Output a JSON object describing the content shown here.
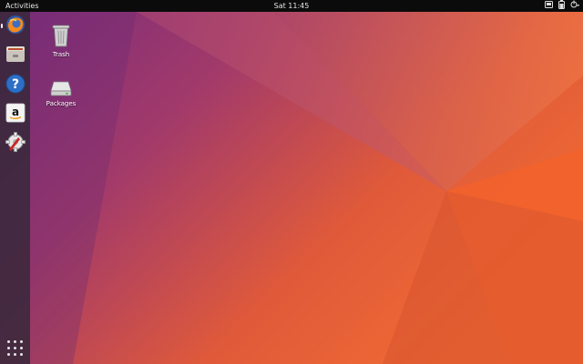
{
  "topbar": {
    "activities_label": "Activities",
    "clock": "Sat 11:45",
    "status_icons": [
      "network-icon",
      "battery-icon",
      "power-menu-icon"
    ]
  },
  "dock": {
    "items": [
      {
        "name": "firefox",
        "icon": "firefox-icon",
        "active": true
      },
      {
        "name": "files",
        "icon": "files-icon",
        "active": false
      },
      {
        "name": "help",
        "icon": "help-icon",
        "active": false
      },
      {
        "name": "amazon",
        "icon": "amazon-icon",
        "active": false
      },
      {
        "name": "software-updater",
        "icon": "software-updater-icon",
        "active": false
      }
    ],
    "show_apps_icon": "app-grid-icon"
  },
  "desktop": {
    "icons": [
      {
        "label": "Trash",
        "icon": "trash-icon"
      },
      {
        "label": "Packages",
        "icon": "drive-icon"
      }
    ]
  },
  "colors": {
    "topbar": "#0b0b0b",
    "dock": "#3c283e",
    "wallpaper_purple": "#7b2f7a",
    "wallpaper_orange": "#e8592c"
  }
}
